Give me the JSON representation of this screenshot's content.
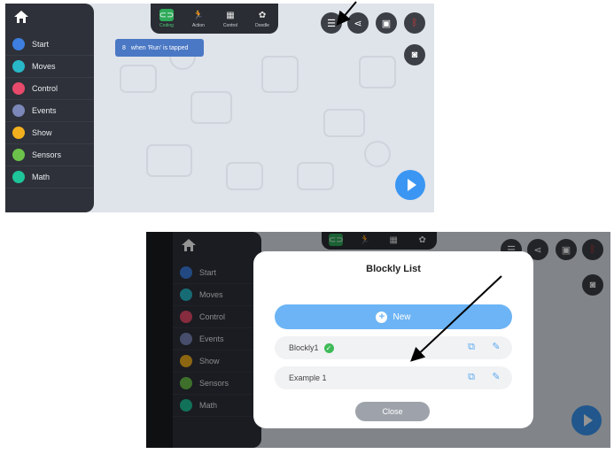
{
  "categories": [
    {
      "label": "Start",
      "color": "#3d7ee0",
      "icon": "start-icon"
    },
    {
      "label": "Moves",
      "color": "#28b8c8",
      "icon": "moves-icon"
    },
    {
      "label": "Control",
      "color": "#e84a6b",
      "icon": "control-icon"
    },
    {
      "label": "Events",
      "color": "#7b87b8",
      "icon": "events-icon"
    },
    {
      "label": "Show",
      "color": "#f2b01e",
      "icon": "show-icon"
    },
    {
      "label": "Sensors",
      "color": "#6cc24a",
      "icon": "sensors-icon"
    },
    {
      "label": "Math",
      "color": "#1ec49a",
      "icon": "math-icon"
    }
  ],
  "tabs": [
    {
      "label": "Coding",
      "icon": "coding-icon"
    },
    {
      "label": "Action",
      "icon": "action-icon"
    },
    {
      "label": "Control",
      "icon": "gamepad-icon"
    },
    {
      "label": "Doodle",
      "icon": "doodle-icon"
    }
  ],
  "block_text": "when 'Run' is tapped",
  "dialog": {
    "title": "Blockly List",
    "new_label": "New",
    "rows": [
      {
        "name": "Blockly1"
      },
      {
        "name": "Example 1"
      }
    ],
    "close_label": "Close"
  },
  "colors": {
    "accent": "#3a96f2",
    "active_tab": "#2faa5a",
    "bluetooth": "#e03a3a"
  }
}
